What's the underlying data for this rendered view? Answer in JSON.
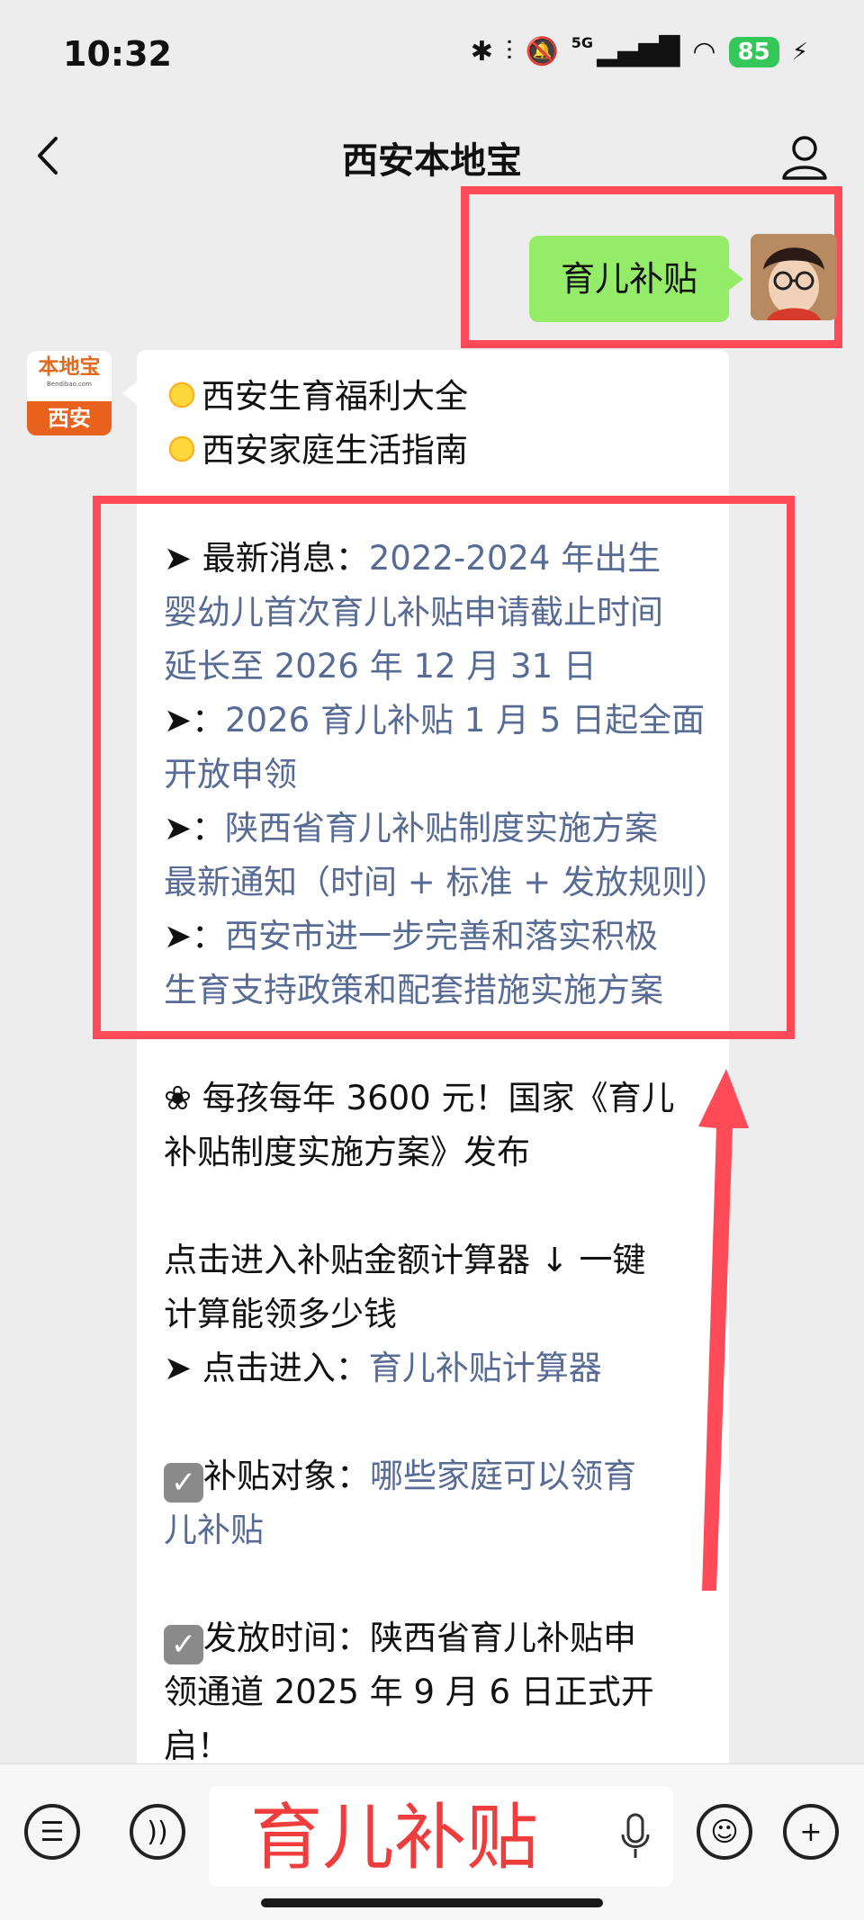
{
  "status": {
    "time": "10:32",
    "network": "5G",
    "battery": "85"
  },
  "nav": {
    "title": "西安本地宝"
  },
  "chat": {
    "user_message": "育儿补贴",
    "bot_avatar": {
      "brand": "本地宝",
      "site": "Bendibao.com",
      "city": "西安"
    },
    "lines": [
      {
        "prefix": "",
        "text": "西安生育福利大全"
      },
      {
        "prefix": "",
        "text": "西安家庭生活指南"
      },
      {
        "prefix": "➤ 最新消息：",
        "text": "2022-2024 年出生"
      },
      {
        "prefix": "",
        "text": "婴幼儿首次育儿补贴申请截止时间"
      },
      {
        "prefix": "",
        "text": "延长至 2026 年 12 月 31 日"
      },
      {
        "prefix": "➤：",
        "text": "2026 育儿补贴 1 月 5 日起全面"
      },
      {
        "prefix": "",
        "text": "开放申领"
      },
      {
        "prefix": "➤：",
        "text": "陕西省育儿补贴制度实施方案"
      },
      {
        "prefix": "",
        "text": "最新通知（时间 + 标准 + 发放规则）"
      },
      {
        "prefix": "➤：",
        "text": "西安市进一步完善和落实积极"
      },
      {
        "prefix": "",
        "text": "生育支持政策和配套措施实施方案"
      },
      {
        "prefix": "",
        "text": "❀ 每孩每年 3600 元！国家《育儿"
      },
      {
        "prefix": "",
        "text": "补贴制度实施方案》发布"
      },
      {
        "prefix": "",
        "text": "点击进入补贴金额计算器 ↓ 一键"
      },
      {
        "prefix": "",
        "text": "计算能领多少钱"
      },
      {
        "prefix": "➤ 点击进入：",
        "text": "育儿补贴计算器"
      },
      {
        "prefix": "补贴对象：",
        "text": "哪些家庭可以领育"
      },
      {
        "prefix": "",
        "text": "儿补贴"
      },
      {
        "prefix": "",
        "text": "发放时间：陕西省育儿补贴申"
      },
      {
        "prefix": "",
        "text": "领通道 2025 年 9 月 6 日正式开"
      },
      {
        "prefix": "",
        "text": "启！"
      }
    ]
  },
  "input": {
    "value": "育儿补贴"
  },
  "colors": {
    "link": "#576b95",
    "highlight_red": "#ff4a58",
    "bubble_green": "#95ec69"
  },
  "icons": [
    "back-arrow-icon",
    "profile-icon",
    "menu-list-icon",
    "voice-icon",
    "microphone-icon",
    "emoji-icon",
    "plus-icon",
    "sun-icon",
    "checkbox-icon"
  ]
}
